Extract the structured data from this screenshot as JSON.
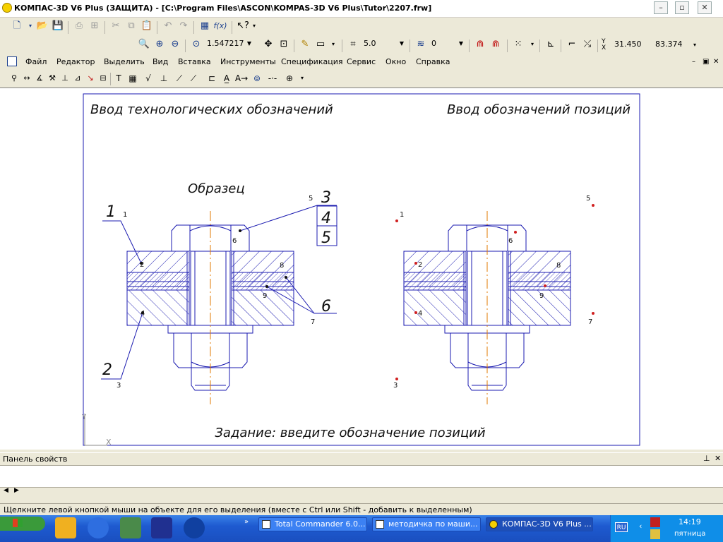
{
  "window": {
    "title": "КОМПАС-3D V6 Plus (ЗАЩИТА) - [C:\\Program Files\\ASCON\\KOMPAS-3D V6 Plus\\Tutor\\2207.frw]"
  },
  "toolbar": {
    "zoom_value": "1.547217",
    "step_value": "5.0",
    "layer_value": "0",
    "coord_x_label": "X",
    "coord_y_label": "Y",
    "coord_x": "31.450",
    "coord_y": "83.374"
  },
  "menu": {
    "items": [
      "Файл",
      "Редактор",
      "Выделить",
      "Вид",
      "Вставка",
      "Инструменты",
      "Спецификация",
      "Сервис",
      "Окно",
      "Справка"
    ]
  },
  "drawing": {
    "header_left": "Ввод технологических обозначений",
    "header_right": "Ввод обозначений позиций",
    "sample_label": "Образец",
    "task_text": "Задание: введите обозначение позиций",
    "leader_numbers": {
      "n1": "1",
      "n2": "2",
      "n3": "3",
      "n4": "4",
      "n5": "5",
      "n6": "6"
    },
    "point_numbers": {
      "p1": "1",
      "p2": "2",
      "p3": "3",
      "p4": "4",
      "p5": "5",
      "p6": "6",
      "p7": "7",
      "p8": "8",
      "p9": "9"
    },
    "axis_x": "X",
    "axis_y": "Y"
  },
  "panel": {
    "title": "Панель свойств"
  },
  "status": {
    "text": "Щелкните левой кнопкой мыши на объекте для его выделения (вместе с Ctrl или Shift - добавить к выделенным)"
  },
  "taskbar": {
    "tasks": [
      "Total Commander 6.0...",
      "методичка по маши...",
      "КОМПАС-3D V6 Plus ..."
    ],
    "lang": "RU",
    "clock": "14:19",
    "day": "пятница"
  },
  "colors": {
    "drawing_line": "#1b1bb0",
    "axis_line": "#e07800",
    "point_marker": "#d02020",
    "taskbar_blue": "#1e5ad0"
  }
}
